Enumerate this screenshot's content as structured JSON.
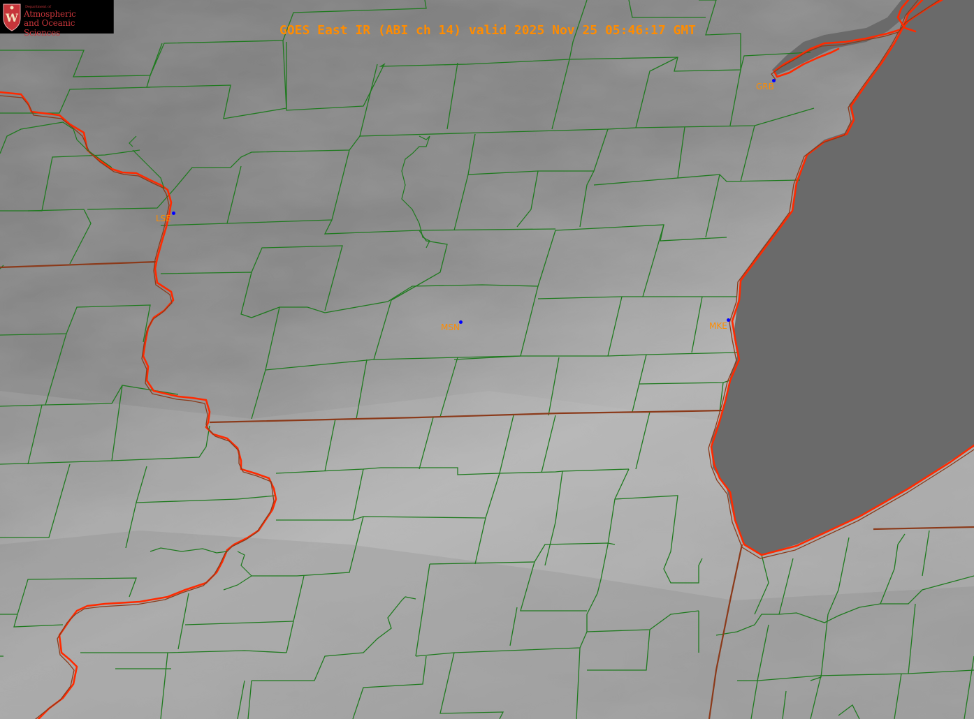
{
  "title": "GOES East IR (ABI ch 14) valid 2025 Nov 25 05:46:17 GMT",
  "logo": {
    "dept": "Department of",
    "line1": "Atmospheric",
    "line2": "and Oceanic Sciences",
    "emblem": "W"
  },
  "stations": [
    {
      "id": "LSE",
      "label": "LSE"
    },
    {
      "id": "GRB",
      "label": "GRB"
    },
    {
      "id": "MSN",
      "label": "MSN"
    },
    {
      "id": "MKE",
      "label": "MKE"
    }
  ],
  "colors": {
    "title": "#ff8c00",
    "station_label": "#ff8c00",
    "station_dot": "#0000ff",
    "county_lines": "#1f7a1f",
    "state_lines": "#8b3a1a",
    "coastline": "#ff2a00",
    "lake_michigan": "#6a6a6a"
  }
}
